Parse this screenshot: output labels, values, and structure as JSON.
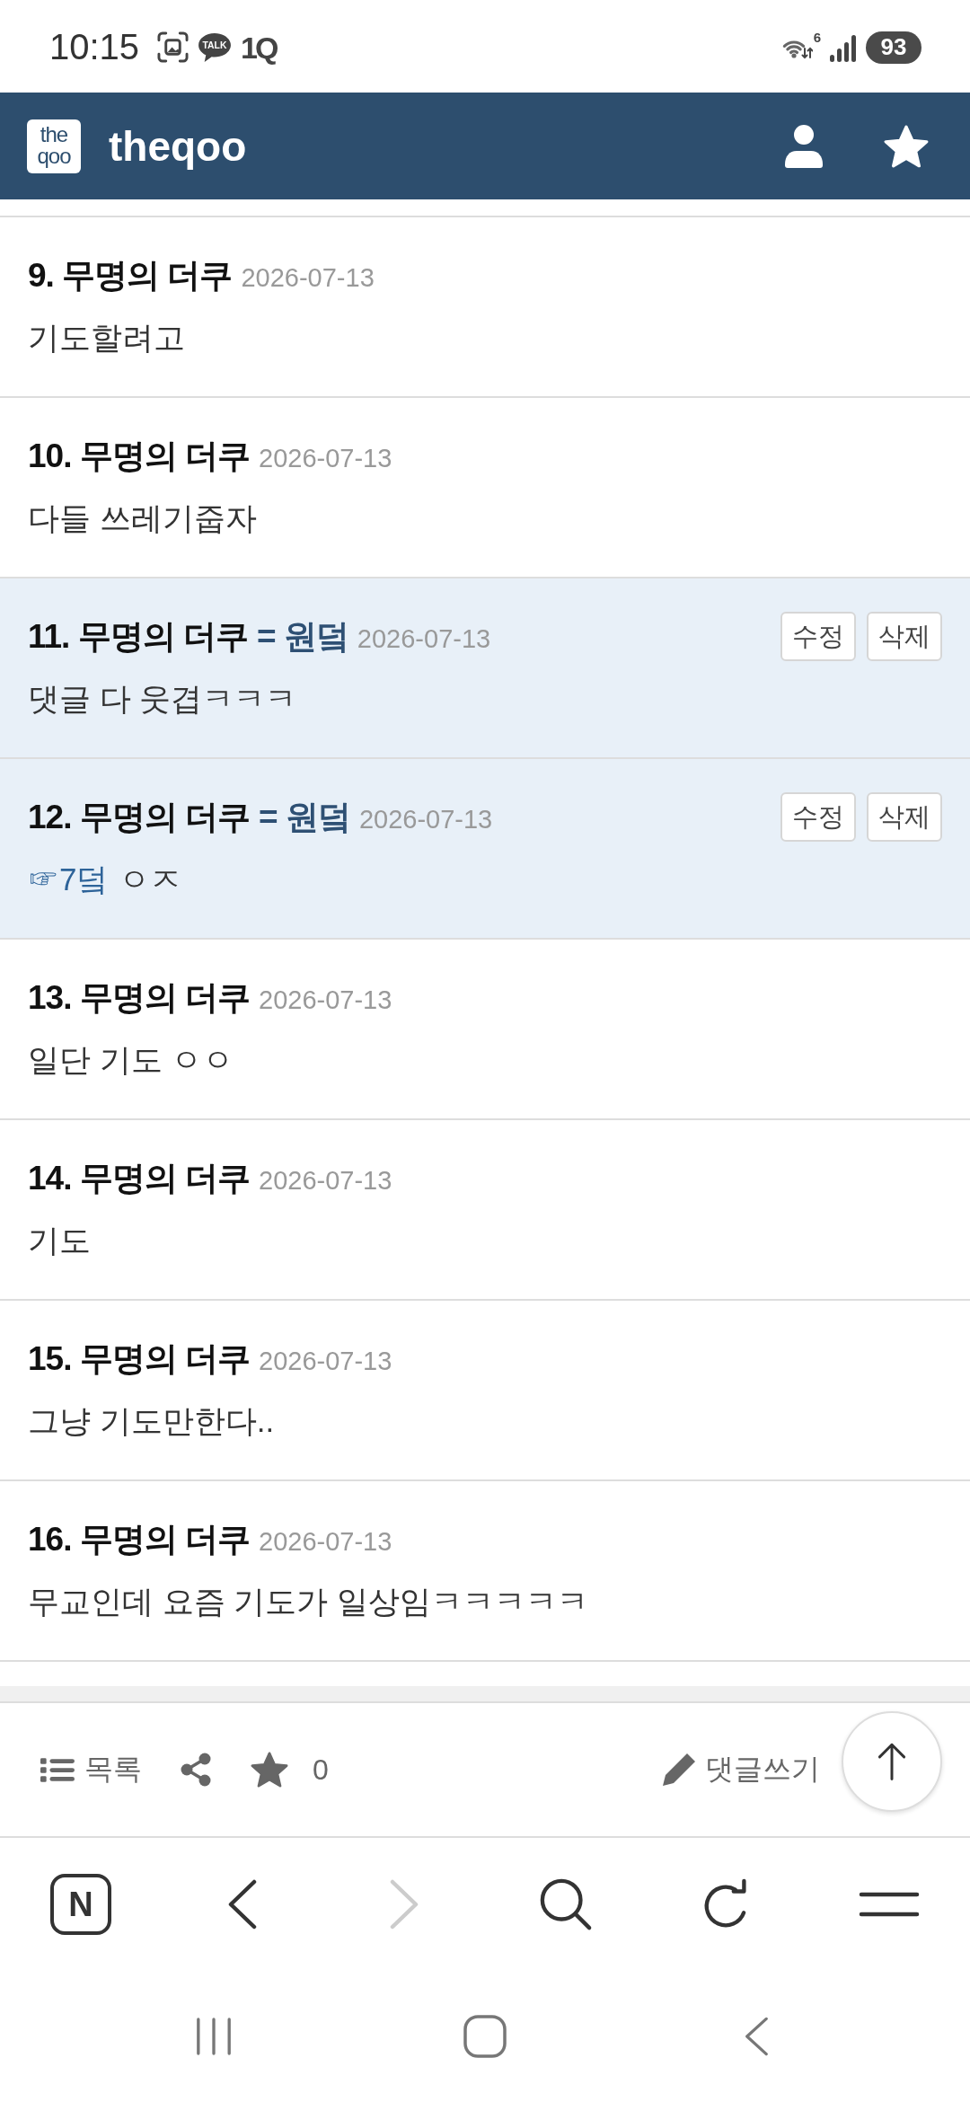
{
  "status_bar": {
    "time": "10:15",
    "notifications": [
      {
        "kind": "screenshot"
      },
      {
        "kind": "talk",
        "label": "TALK"
      },
      {
        "kind": "app",
        "label": "1Q"
      }
    ],
    "wifi_label": "6",
    "battery": "93"
  },
  "header": {
    "logo_lines": [
      "the",
      "qoo"
    ],
    "title": "theqoo",
    "actions": [
      {
        "kind": "profile"
      },
      {
        "kind": "favorite"
      }
    ]
  },
  "comments": [
    {
      "author": "9. 무명의 더쿠",
      "date": "2026-07-13",
      "text": "기도할려고",
      "highlighted": false
    },
    {
      "author": "10. 무명의 더쿠",
      "date": "2026-07-13",
      "text": "다들 쓰레기줍자",
      "highlighted": false
    },
    {
      "author": "11. 무명의 더쿠",
      "author_tag": "= 원덬",
      "date": "2026-07-13",
      "text": "댓글 다 웃겹ㅋㅋㅋ",
      "highlighted": true,
      "buttons": [
        "수정",
        "삭제"
      ]
    },
    {
      "author": "12. 무명의 더쿠",
      "author_tag": "= 원덬",
      "date": "2026-07-13",
      "reply_to": "☞7덬",
      "text": "ㅇㅈ",
      "highlighted": true,
      "buttons": [
        "수정",
        "삭제"
      ]
    },
    {
      "author": "13. 무명의 더쿠",
      "date": "2026-07-13",
      "text": "일단 기도 ㅇㅇ",
      "highlighted": false
    },
    {
      "author": "14. 무명의 더쿠",
      "date": "2026-07-13",
      "text": "기도",
      "highlighted": false
    },
    {
      "author": "15. 무명의 더쿠",
      "date": "2026-07-13",
      "text": "그냥 기도만한다..",
      "highlighted": false
    },
    {
      "author": "16. 무명의 더쿠",
      "date": "2026-07-13",
      "text": "무교인데 요즘 기도가 일상임ㅋㅋㅋㅋㅋ",
      "highlighted": false
    }
  ],
  "toolbar": {
    "list_label": "목록",
    "star_count": "0",
    "write_label": "댓글쓰기"
  },
  "browser_nav": [
    {
      "kind": "home",
      "label": "N",
      "disabled": false
    },
    {
      "kind": "back",
      "disabled": false
    },
    {
      "kind": "forward",
      "disabled": true
    },
    {
      "kind": "search",
      "disabled": false
    },
    {
      "kind": "refresh",
      "disabled": false
    },
    {
      "kind": "menu",
      "disabled": false
    }
  ],
  "system_nav": [
    {
      "kind": "recents"
    },
    {
      "kind": "home"
    },
    {
      "kind": "back"
    }
  ]
}
